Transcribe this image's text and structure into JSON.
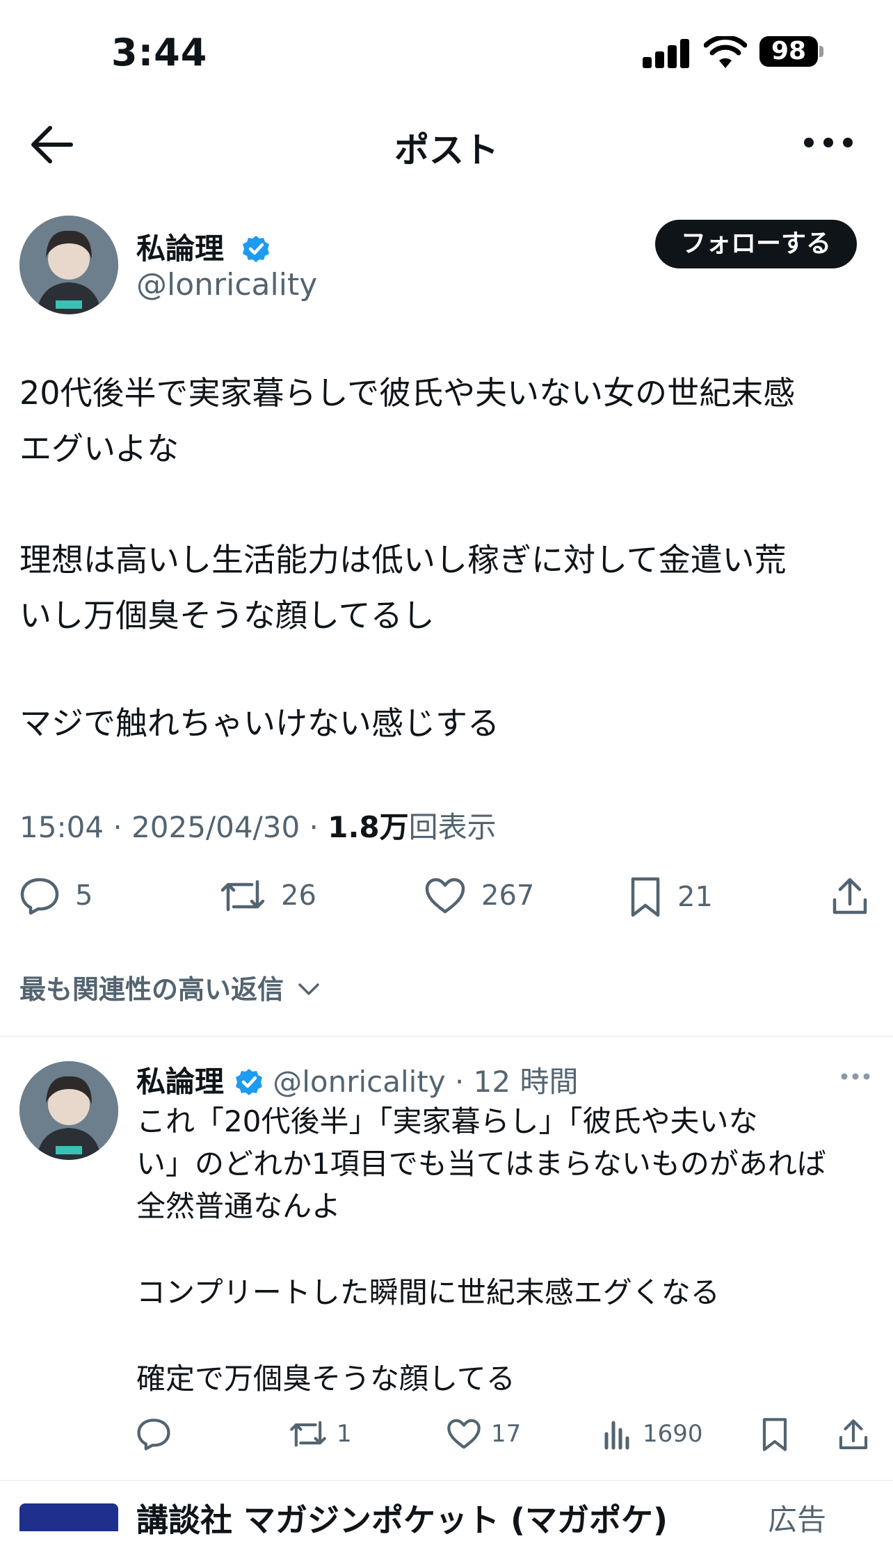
{
  "status_bar": {
    "time": "3:44",
    "battery": "98"
  },
  "header": {
    "title": "ポスト"
  },
  "post": {
    "author_name": "私論理",
    "author_handle": "@lonricality",
    "follow_label": "フォローする",
    "paragraphs": [
      "20代後半で実家暮らしで彼氏や夫いない女の世紀末感\nエグいよな",
      "理想は高いし生活能力は低いし稼ぎに対して金遣い荒\nいし万個臭そうな顔してるし",
      "マジで触れちゃいけない感じする"
    ],
    "time": "15:04 · 2025/04/30 · ",
    "views_count": "1.8万",
    "views_label": "回表示",
    "stats": {
      "replies": "5",
      "reposts": "26",
      "likes": "267",
      "bookmarks": "21"
    }
  },
  "replies_sort": {
    "label": "最も関連性の高い返信"
  },
  "reply": {
    "author_name": "私論理",
    "meta": "@lonricality · 12 時間",
    "paragraphs": [
      "これ「20代後半」「実家暮らし」「彼氏や夫いな\nい」のどれか1項目でも当てはまらないものがあれば\n全然普通なんよ",
      "コンプリートした瞬間に世紀末感エグくなる",
      "確定で万個臭そうな顔してる"
    ],
    "stats": {
      "reposts": "1",
      "likes": "17",
      "views": "1690"
    }
  },
  "ad_preview": {
    "name": "講談社 マガジンポケット (マガポケ)",
    "label": "広告"
  },
  "colors": {
    "text": "#0f1419",
    "secondary": "#536471",
    "verified": "#1d9bf0",
    "divider": "#eff3f4"
  }
}
